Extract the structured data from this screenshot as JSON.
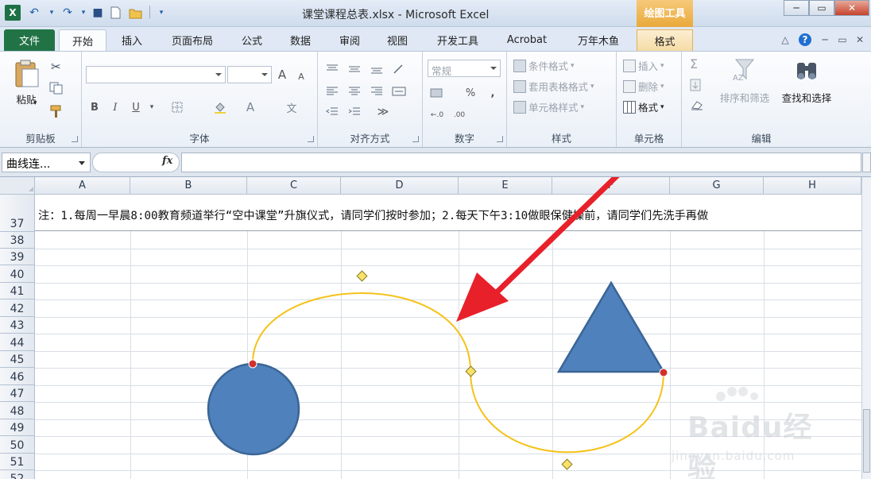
{
  "app": {
    "logo": "X",
    "document_title": "课堂课程总表.xlsx - Microsoft Excel",
    "contextual_tab_title": "绘图工具",
    "window_controls": {
      "minimize": "─",
      "restore": "▭",
      "close": "✕"
    },
    "quick_access": {
      "undo": "↶",
      "redo": "↷",
      "save": "■"
    }
  },
  "tabs": [
    "文件",
    "开始",
    "插入",
    "页面布局",
    "公式",
    "数据",
    "审阅",
    "视图",
    "开发工具",
    "Acrobat",
    "万年木鱼",
    "格式"
  ],
  "active_tab": "开始",
  "ribbon": {
    "clipboard": {
      "paste": "粘贴",
      "label": "剪贴板"
    },
    "font": {
      "label": "字体",
      "bold": "B",
      "italic": "I",
      "underline": "U",
      "grow": "A",
      "shrink": "A",
      "font_color": "A",
      "phonetic": "文"
    },
    "alignment": {
      "label": "对齐方式"
    },
    "number": {
      "label": "数字",
      "format_value": "常规",
      "percent": "%",
      "comma": ","
    },
    "styles": {
      "label": "样式",
      "conditional": "条件格式",
      "table": "套用表格格式",
      "cell_styles": "单元格样式"
    },
    "cells": {
      "label": "单元格",
      "insert": "插入",
      "delete": "删除",
      "format": "格式"
    },
    "editing": {
      "label": "编辑",
      "sum": "Σ",
      "sort_filter": "排序和筛选",
      "find_select": "查找和选择"
    }
  },
  "formula_bar": {
    "name_box": "曲线连...",
    "fx": "fx",
    "formula": ""
  },
  "sheet": {
    "columns": [
      "A",
      "B",
      "C",
      "D",
      "E",
      "F",
      "G",
      "H"
    ],
    "rows": [
      "37",
      "38",
      "39",
      "40",
      "41",
      "42",
      "43",
      "44",
      "45",
      "46",
      "47",
      "48",
      "49",
      "50",
      "51",
      "52"
    ],
    "note_text": "注：1.每周一早晨8:00教育频道举行“空中课堂”升旗仪式，请同学们按时参加；2.每天下午3:10做眼保健操前，请同学们先洗手再做"
  },
  "colors": {
    "shape_fill": "#4f81bd",
    "shape_stroke": "#3a6596",
    "connector": "#f5c21a",
    "arrow": "#e8202a",
    "handle_red": "#d0312d",
    "handle_yellow": "#f7e26b",
    "excel_green": "#217346"
  },
  "watermark": {
    "brand": "Baidu经验",
    "url": "jingyan.baidu.com"
  }
}
